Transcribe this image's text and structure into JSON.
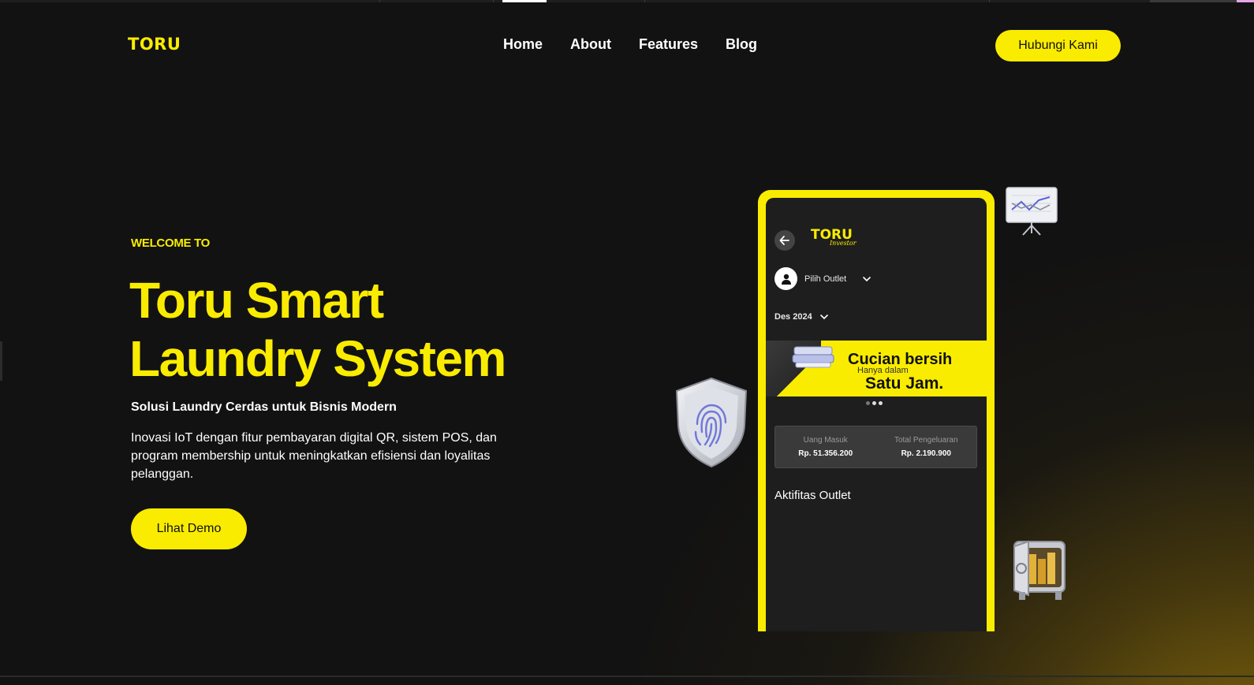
{
  "header": {
    "logo": "TORU",
    "nav": [
      "Home",
      "About",
      "Features",
      "Blog"
    ],
    "cta": "Hubungi Kami"
  },
  "hero": {
    "eyebrow": "WELCOME TO",
    "title_line1": "Toru Smart",
    "title_line2": "Laundry System",
    "subtitle": "Solusi Laundry Cerdas untuk Bisnis Modern",
    "description": "Inovasi IoT dengan fitur pembayaran digital QR, sistem POS, dan program membership untuk meningkatkan efisiensi dan loyalitas pelanggan.",
    "cta": "Lihat Demo"
  },
  "phone": {
    "app_logo": "TORU",
    "app_tag": "Investor",
    "outlet_label": "Pilih Outlet",
    "date_label": "Des 2024",
    "banner": {
      "line1": "Cucian bersih",
      "line2": "Hanya dalam",
      "line3": "Satu Jam."
    },
    "stats": [
      {
        "label": "Uang Masuk",
        "value": "Rp. 51.356.200"
      },
      {
        "label": "Total Pengeluaran",
        "value": "Rp. 2.190.900"
      }
    ],
    "activity_title": "Aktifitas Outlet"
  },
  "colors": {
    "accent": "#f9ec00",
    "background": "#121212",
    "phone_screen": "#1e1e1e"
  },
  "icons": [
    "arrow-left-icon",
    "user-icon",
    "chevron-down-icon",
    "fingerprint-shield-icon",
    "chart-board-icon",
    "safe-icon"
  ]
}
